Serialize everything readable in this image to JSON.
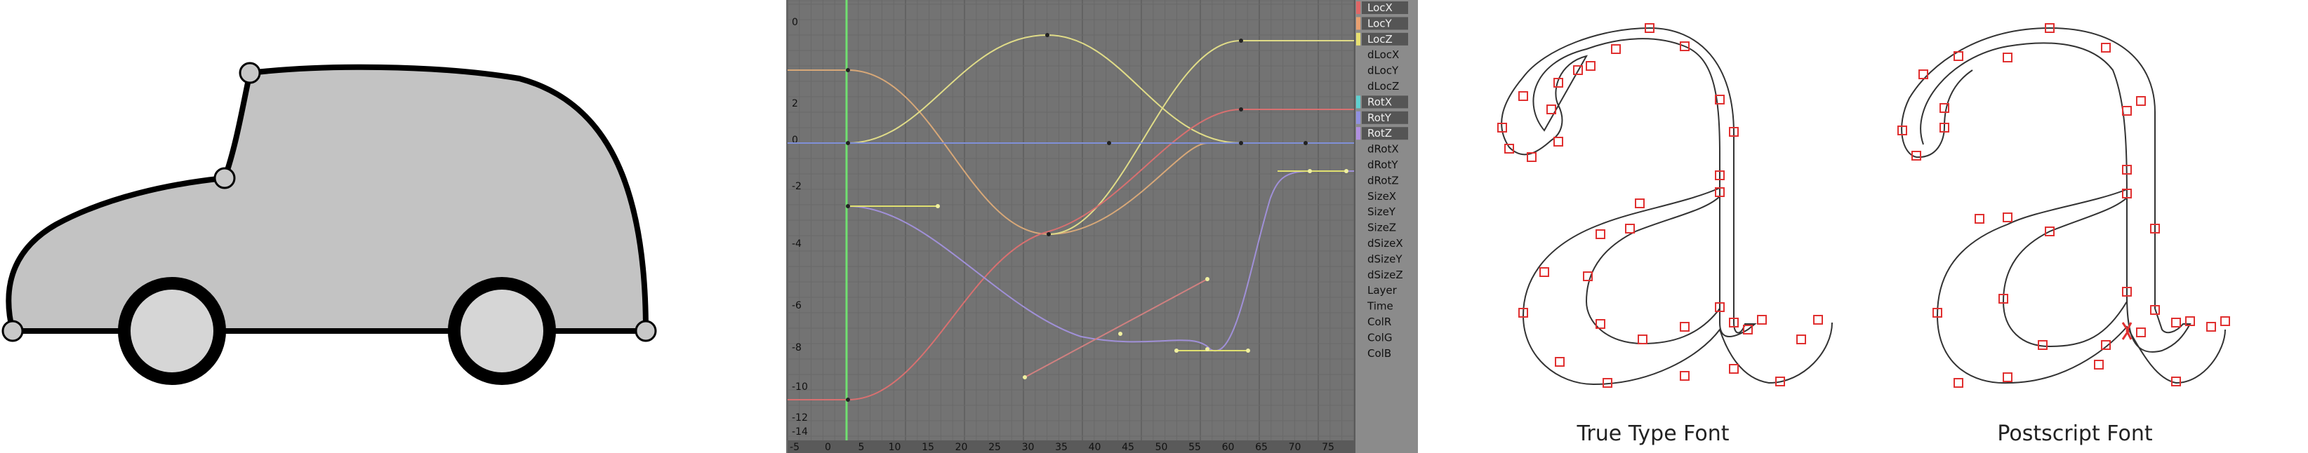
{
  "graph": {
    "y_ticks": [
      "0",
      "2",
      "0",
      "-2",
      "-4",
      "-6",
      "-8",
      "-10",
      "-12",
      "-14"
    ],
    "x_ticks": [
      "-5",
      "0",
      "5",
      "10",
      "15",
      "20",
      "25",
      "30",
      "35",
      "40",
      "45",
      "50",
      "55",
      "60",
      "65",
      "70",
      "75"
    ],
    "channels": [
      {
        "label": "LocX",
        "color": "#e06666",
        "box": true
      },
      {
        "label": "LocY",
        "color": "#e8a070",
        "box": true
      },
      {
        "label": "LocZ",
        "color": "#e8e070",
        "box": true
      },
      {
        "label": "dLocX",
        "box": false
      },
      {
        "label": "dLocY",
        "box": false
      },
      {
        "label": "dLocZ",
        "box": false
      },
      {
        "label": "RotX",
        "color": "#60d0d0",
        "box": true
      },
      {
        "label": "RotY",
        "color": "#9090e0",
        "box": true
      },
      {
        "label": "RotZ",
        "color": "#b090e0",
        "box": true
      },
      {
        "label": "dRotX",
        "box": false
      },
      {
        "label": "dRotY",
        "box": false
      },
      {
        "label": "dRotZ",
        "box": false
      },
      {
        "label": "SizeX",
        "box": false
      },
      {
        "label": "SizeY",
        "box": false
      },
      {
        "label": "SizeZ",
        "box": false
      },
      {
        "label": "dSizeX",
        "box": false
      },
      {
        "label": "dSizeY",
        "box": false
      },
      {
        "label": "dSizeZ",
        "box": false
      },
      {
        "label": "Layer",
        "box": false
      },
      {
        "label": "Time",
        "box": false
      },
      {
        "label": "ColR",
        "box": false
      },
      {
        "label": "ColG",
        "box": false
      },
      {
        "label": "ColB",
        "box": false
      }
    ]
  },
  "fonts": {
    "truetype_caption": "True Type Font",
    "postscript_caption": "Postscript Font"
  }
}
